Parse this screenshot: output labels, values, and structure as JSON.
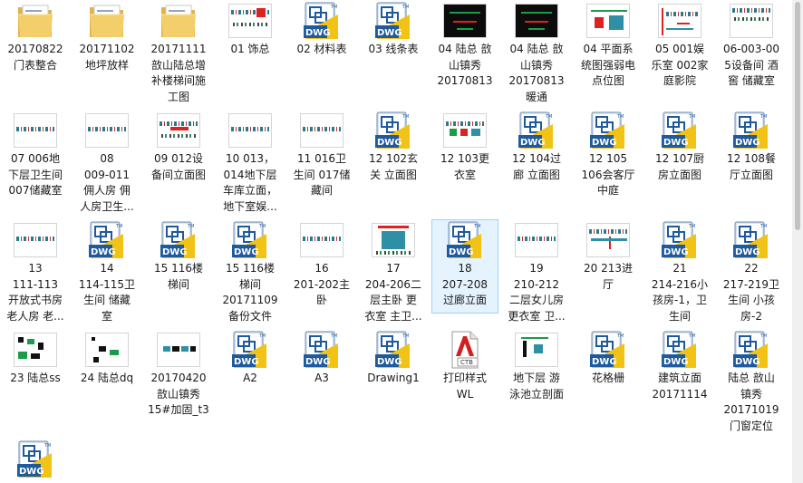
{
  "files": [
    {
      "label": "20170822\n门表整合",
      "icon": "folder-icon",
      "thumb": "folder"
    },
    {
      "label": "20171102\n地坪放样",
      "icon": "folder-icon",
      "thumb": "folder"
    },
    {
      "label": "20171111\n敨山陆总增\n补楼梯间施\n工图",
      "icon": "folder-icon",
      "thumb": "folder"
    },
    {
      "label": "01 饰总",
      "icon": "drawing-thumbnail-icon",
      "thumb": "t1"
    },
    {
      "label": "02 材料表",
      "icon": "dwg-file-icon",
      "thumb": "dwg"
    },
    {
      "label": "03 线条表",
      "icon": "dwg-file-icon",
      "thumb": "dwg"
    },
    {
      "label": "04 陆总 敨\n山镇秀\n20170813",
      "icon": "drawing-thumbnail-icon",
      "thumb": "t2"
    },
    {
      "label": "04 陆总 敨\n山镇秀\n20170813\n暖通",
      "icon": "drawing-thumbnail-icon",
      "thumb": "t2"
    },
    {
      "label": "04 平面系\n统图强弱电\n点位图",
      "icon": "drawing-thumbnail-icon",
      "thumb": "t3"
    },
    {
      "label": "05 001娱\n乐室 002家\n庭影院",
      "icon": "drawing-thumbnail-icon",
      "thumb": "t4"
    },
    {
      "label": "06-003-00\n5设备间 酒\n窖 储藏室",
      "icon": "drawing-thumbnail-icon",
      "thumb": "t5"
    },
    {
      "label": "07 006地\n下层卫生间\n007储藏室",
      "icon": "drawing-thumbnail-icon",
      "thumb": "t6"
    },
    {
      "label": "08\n009-011\n佣人房 佣\n人房卫生...",
      "icon": "drawing-thumbnail-icon",
      "thumb": "t6"
    },
    {
      "label": "09 012设\n备间立面图",
      "icon": "drawing-thumbnail-icon",
      "thumb": "t7"
    },
    {
      "label": "10 013，\n014地下层\n车库立面，\n地下室娱...",
      "icon": "drawing-thumbnail-icon",
      "thumb": "t6"
    },
    {
      "label": "11 016卫\n生间 017储\n藏间",
      "icon": "drawing-thumbnail-icon",
      "thumb": "t6"
    },
    {
      "label": "12 102玄\n关 立面图",
      "icon": "dwg-file-icon",
      "thumb": "dwg"
    },
    {
      "label": "12 103更\n衣室",
      "icon": "drawing-thumbnail-icon",
      "thumb": "t8"
    },
    {
      "label": "12 104过\n廊 立面图",
      "icon": "dwg-file-icon",
      "thumb": "dwg"
    },
    {
      "label": "12 105\n106会客厅\n中庭",
      "icon": "dwg-file-icon",
      "thumb": "dwg"
    },
    {
      "label": "12 107厨\n房立面图",
      "icon": "dwg-file-icon",
      "thumb": "dwg"
    },
    {
      "label": "12 108餐\n厅立面图",
      "icon": "dwg-file-icon",
      "thumb": "dwg"
    },
    {
      "label": "13\n111-113\n开放式书房\n老人房 老...",
      "icon": "drawing-thumbnail-icon",
      "thumb": "t6"
    },
    {
      "label": "14\n114-115卫\n生间 储藏\n室",
      "icon": "dwg-file-icon",
      "thumb": "dwg"
    },
    {
      "label": "15 116楼\n梯间",
      "icon": "dwg-file-icon",
      "thumb": "dwg"
    },
    {
      "label": "15 116楼\n梯间\n20171109\n备份文件",
      "icon": "dwg-file-icon",
      "thumb": "dwg"
    },
    {
      "label": "16\n201-202主\n卧",
      "icon": "drawing-thumbnail-icon",
      "thumb": "t6"
    },
    {
      "label": "17\n204-206二\n层主卧 更\n衣室 主卫...",
      "icon": "drawing-thumbnail-icon",
      "thumb": "t9"
    },
    {
      "label": "18\n207-208\n过廊立面",
      "icon": "dwg-file-icon",
      "thumb": "dwg",
      "selected": true
    },
    {
      "label": "19\n210-212\n二层女儿房\n更衣室 卫...",
      "icon": "drawing-thumbnail-icon",
      "thumb": "t6"
    },
    {
      "label": "20 213进\n厅",
      "icon": "drawing-thumbnail-icon",
      "thumb": "t10"
    },
    {
      "label": "21\n214-216小\n孩房-1，卫\n生间",
      "icon": "dwg-file-icon",
      "thumb": "dwg"
    },
    {
      "label": "22\n217-219卫\n生间 小孩\n房-2",
      "icon": "dwg-file-icon",
      "thumb": "dwg"
    },
    {
      "label": "23 陆总ss",
      "icon": "drawing-thumbnail-icon",
      "thumb": "t11"
    },
    {
      "label": "24 陆总dq",
      "icon": "drawing-thumbnail-icon",
      "thumb": "t12"
    },
    {
      "label": "20170420\n敨山镇秀\n15#加固_t3",
      "icon": "drawing-thumbnail-icon",
      "thumb": "t13"
    },
    {
      "label": "A2",
      "icon": "dwg-file-icon",
      "thumb": "dwg"
    },
    {
      "label": "A3",
      "icon": "dwg-file-icon",
      "thumb": "dwg"
    },
    {
      "label": "Drawing1",
      "icon": "dwg-file-icon",
      "thumb": "dwg"
    },
    {
      "label": "打印样式\nWL",
      "icon": "ctb-file-icon",
      "thumb": "ctb",
      "badge": "CTB"
    },
    {
      "label": "地下层 游\n泳池立剖面",
      "icon": "drawing-thumbnail-icon",
      "thumb": "t14"
    },
    {
      "label": "花格栅",
      "icon": "dwg-file-icon",
      "thumb": "dwg"
    },
    {
      "label": "建筑立面\n20171114",
      "icon": "dwg-file-icon",
      "thumb": "dwg"
    },
    {
      "label": "陆总 敨山\n镇秀\n20171019\n门窗定位",
      "icon": "dwg-file-icon",
      "thumb": "dwg"
    },
    {
      "label": "",
      "icon": "dwg-file-icon",
      "thumb": "dwg"
    }
  ],
  "dwg_icon": {
    "text": "DWG",
    "tm": "TM"
  },
  "colors": {
    "selection_bg": "#e5f3ff",
    "selection_border": "#99d1ff",
    "dwg_blue": "#1f5a9c",
    "dwg_yellow": "#f2c317"
  }
}
